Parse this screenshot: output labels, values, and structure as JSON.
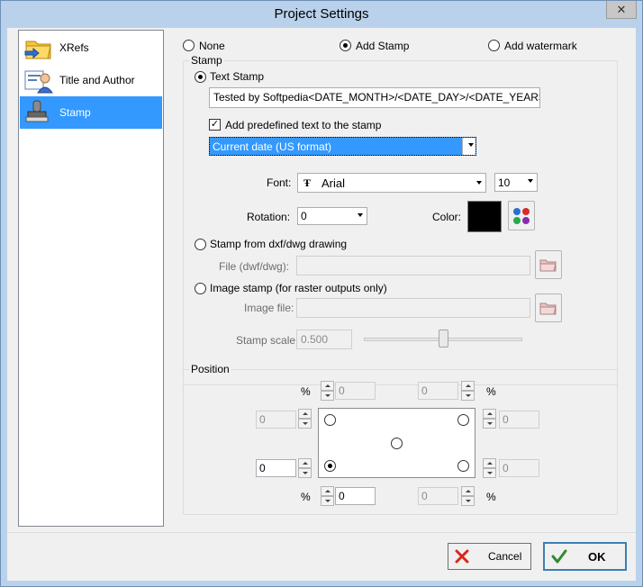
{
  "window": {
    "title": "Project Settings",
    "close_glyph": "✕"
  },
  "sidebar": {
    "items": [
      {
        "label": "XRefs",
        "icon": "folder-icon"
      },
      {
        "label": "Title and Author",
        "icon": "user-icon"
      },
      {
        "label": "Stamp",
        "icon": "stamp-icon",
        "selected": true
      }
    ]
  },
  "stamp_mode": {
    "none_label": "None",
    "add_stamp_label": "Add Stamp",
    "add_watermark_label": "Add watermark",
    "selected": "Add Stamp"
  },
  "stamp_group": {
    "title": "Stamp",
    "text_stamp_label": "Text Stamp",
    "text_value": "Tested by Softpedia<DATE_MONTH>/<DATE_DAY>/<DATE_YEAR>",
    "add_predefined_label": "Add predefined text to the stamp",
    "add_predefined_checked": true,
    "predefined_value": "Current date (US format)",
    "font_label": "Font:",
    "font_value": "Arial",
    "font_size": "10",
    "rotation_label": "Rotation:",
    "rotation_value": "0",
    "color_label": "Color:",
    "color_value": "#000000",
    "dxf_label": "Stamp from dxf/dwg drawing",
    "file_label": "File (dwf/dwg):",
    "file_value": "",
    "image_stamp_label": "Image stamp (for raster outputs only)",
    "image_file_label": "Image file:",
    "image_file_value": "",
    "stamp_scale_label": "Stamp scale:",
    "stamp_scale_value": "0.500",
    "stamp_scale_level": 0.5
  },
  "position_group": {
    "title": "Position",
    "percent": "%",
    "top_left_offset": "0",
    "top_right_offset": "0",
    "left_top_offset": "0",
    "right_top_offset": "0",
    "left_bottom_offset": "0",
    "right_bottom_offset": "0",
    "bottom_left_offset": "0",
    "bottom_right_offset": "0",
    "selected_anchor": "bottom-left"
  },
  "buttons": {
    "cancel_label": "Cancel",
    "ok_label": "OK"
  },
  "colors": {
    "selection": "#3399ff",
    "cancel_x": "#d9261c",
    "ok_check": "#2e8b2e"
  }
}
